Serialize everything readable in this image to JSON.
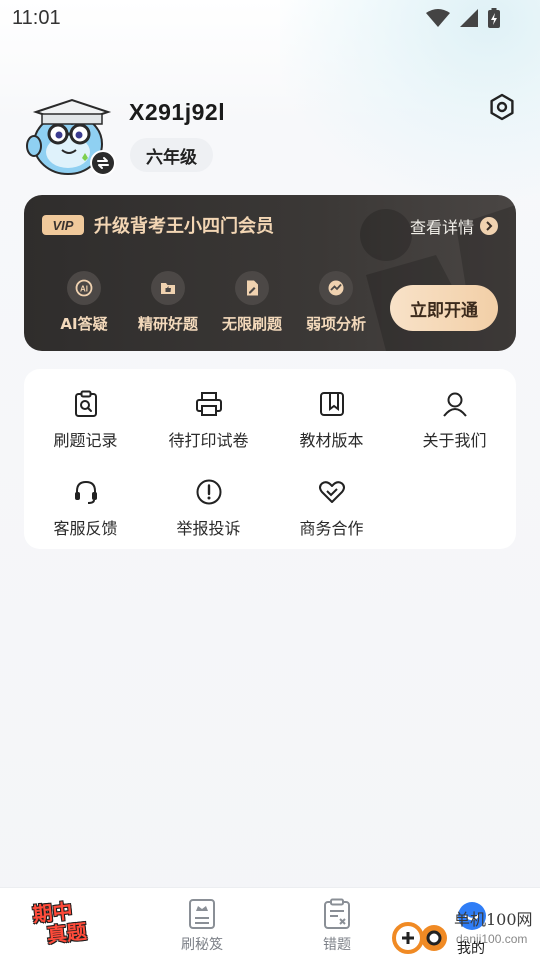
{
  "status_bar": {
    "time": "11:01"
  },
  "profile": {
    "username": "X291j92l",
    "grade": "六年级"
  },
  "vip": {
    "logo": "VIP",
    "title": "升级背考王小四门会员",
    "detail_label": "查看详情",
    "features": [
      {
        "label": "AI答疑",
        "icon": "ai-icon"
      },
      {
        "label": "精研好题",
        "icon": "thumbs-up-folder-icon"
      },
      {
        "label": "无限刷题",
        "icon": "document-pen-icon"
      },
      {
        "label": "弱项分析",
        "icon": "chart-icon"
      }
    ],
    "cta_label": "立即开通",
    "colors": {
      "card_bg": "#343130",
      "gold_text": "#f3d6b4",
      "cta_bg": "#f5d8b8"
    }
  },
  "tools": {
    "items": [
      {
        "label": "刷题记录",
        "icon": "clipboard-search-icon"
      },
      {
        "label": "待打印试卷",
        "icon": "printer-icon"
      },
      {
        "label": "教材版本",
        "icon": "book-icon"
      },
      {
        "label": "关于我们",
        "icon": "user-icon"
      },
      {
        "label": "客服反馈",
        "icon": "headset-icon"
      },
      {
        "label": "举报投诉",
        "icon": "alert-circle-icon"
      },
      {
        "label": "商务合作",
        "icon": "handshake-heart-icon"
      }
    ]
  },
  "bottom_nav": {
    "promo_line1": "期中",
    "promo_line2": "真题",
    "items": [
      {
        "label": "刷秘笈",
        "icon": "book-crown-icon"
      },
      {
        "label": "错题",
        "icon": "clipboard-x-icon"
      },
      {
        "label": "我的",
        "icon": "profile-icon"
      }
    ]
  },
  "watermark": {
    "line1": "单机100网",
    "line2": "danji100.com"
  }
}
